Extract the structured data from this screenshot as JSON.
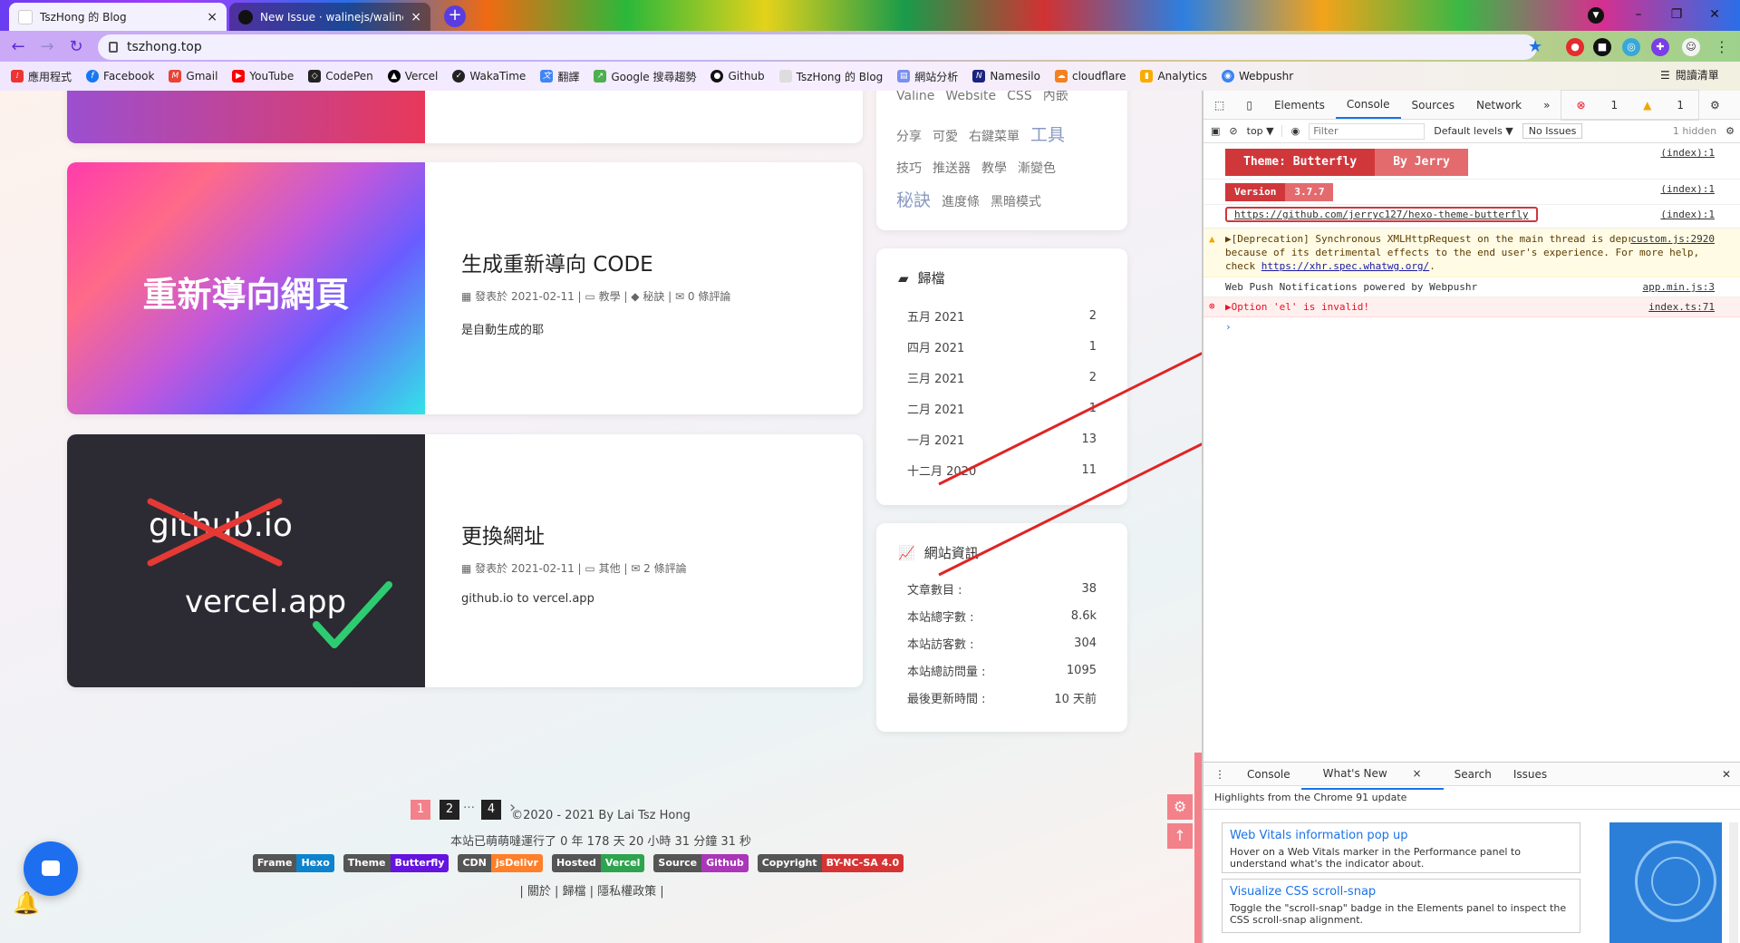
{
  "browser": {
    "tabs": [
      {
        "title": "TszHong 的 Blog",
        "close": "×"
      },
      {
        "title": "New Issue · walinejs/waline",
        "close": "×"
      }
    ],
    "new_tab": "+",
    "url": "tszhong.top",
    "window_controls": [
      "–",
      "❐",
      "✕"
    ],
    "bookmarks": [
      "應用程式",
      "Facebook",
      "Gmail",
      "YouTube",
      "CodePen",
      "Vercel",
      "WakaTime",
      "翻譯",
      "Google 搜尋趨勢",
      "Github",
      "TszHong 的 Blog",
      "網站分析",
      "Namesilo",
      "cloudflare",
      "Analytics",
      "Webpushr"
    ],
    "reading_list": "閱讀清單"
  },
  "blog": {
    "posts": [
      {
        "title": "生成重新導向 CODE",
        "cover_text": "重新導向網頁",
        "date": "發表於 2021-02-11",
        "category": "教學",
        "tag": "秘訣",
        "comments": "0 條評論",
        "excerpt": "是自動生成的耶"
      },
      {
        "title": "更換網址",
        "cover_text1": "github.io",
        "cover_text2": "vercel.app",
        "date": "發表於 2021-02-11",
        "category": "其他",
        "comments": "2 條評論",
        "excerpt": "github.io to vercel.app"
      }
    ],
    "tags_row0": [
      "Valine",
      "Website",
      "CSS",
      "內嵌"
    ],
    "tags": [
      "分享",
      "可愛",
      "右鍵菜單",
      "工具",
      "技巧",
      "推送器",
      "教學",
      "漸變色",
      "秘訣",
      "進度條",
      "黑暗模式"
    ],
    "archive": {
      "title": "歸檔",
      "items": [
        {
          "label": "五月 2021",
          "count": "2"
        },
        {
          "label": "四月 2021",
          "count": "1"
        },
        {
          "label": "三月 2021",
          "count": "2"
        },
        {
          "label": "二月 2021",
          "count": "1"
        },
        {
          "label": "一月 2021",
          "count": "13"
        },
        {
          "label": "十二月 2020",
          "count": "11"
        }
      ]
    },
    "siteinfo": {
      "title": "網站資訊",
      "items": [
        {
          "label": "文章數目 :",
          "value": "38"
        },
        {
          "label": "本站總字數 :",
          "value": "8.6k"
        },
        {
          "label": "本站訪客數 :",
          "value": "304"
        },
        {
          "label": "本站總訪問量 :",
          "value": "1095"
        },
        {
          "label": "最後更新時間 :",
          "value": "10 天前"
        }
      ]
    },
    "pagination": [
      "1",
      "2",
      "…",
      "4",
      "›"
    ],
    "footer": {
      "copyright": "©2020 - 2021 By Lai Tsz Hong",
      "runtime": "本站已萌萌噠運行了 0 年 178 天 20 小時 31 分鐘 31 秒",
      "badges": [
        {
          "l": "Frame",
          "r": "Hexo",
          "color": "#0e83cd"
        },
        {
          "l": "Theme",
          "r": "Butterfly",
          "color": "#6513df"
        },
        {
          "l": "CDN",
          "r": "jsDelivr",
          "color": "#ff7f2a"
        },
        {
          "l": "Hosted",
          "r": "Vercel",
          "color": "#2ea44f"
        },
        {
          "l": "Source",
          "r": "Github",
          "color": "#a937b8"
        },
        {
          "l": "Copyright",
          "r": "BY-NC-SA 4.0",
          "color": "#d63333"
        }
      ],
      "links": "| 關於 | 歸檔 | 隱私權政策 |"
    }
  },
  "devtools": {
    "tabs": [
      "Elements",
      "Console",
      "Sources",
      "Network",
      "»"
    ],
    "counts": {
      "errors": "1",
      "warnings": "1"
    },
    "toolbar": {
      "context": "top ▼",
      "filter_placeholder": "Filter",
      "levels": "Default levels ▼",
      "issues": "No Issues",
      "hidden": "1 hidden"
    },
    "console": [
      {
        "type": "banner",
        "l": "Theme: Butterfly",
        "r": "By Jerry",
        "src": "(index):1"
      },
      {
        "type": "version",
        "l": "Version",
        "r": "3.7.7",
        "src": "(index):1"
      },
      {
        "type": "link",
        "text": "https://github.com/jerryc127/hexo-theme-butterfly",
        "src": "(index):1"
      },
      {
        "type": "warn",
        "text": "▶[Deprecation] Synchronous XMLHttpRequest on the main thread is deprecated because of its detrimental effects to the end user's experience. For more help, check",
        "link": "https://xhr.spec.whatwg.org/",
        "src": "custom.js:2920"
      },
      {
        "type": "log",
        "text": "Web Push Notifications powered by Webpushr",
        "src": "app.min.js:3"
      },
      {
        "type": "error",
        "text": "▶Option 'el' is invalid!",
        "src": "index.ts:71"
      }
    ],
    "prompt": "›",
    "drawer": {
      "tabs": [
        "Console",
        "What's New",
        "Search",
        "Issues"
      ],
      "heading": "Highlights from the Chrome 91 update",
      "cards": [
        {
          "title": "Web Vitals information pop up",
          "text": "Hover on a Web Vitals marker in the Performance panel to understand what's the indicator about."
        },
        {
          "title": "Visualize CSS scroll-snap",
          "text": "Toggle the \"scroll-snap\" badge in the Elements panel to inspect the CSS scroll-snap alignment."
        }
      ]
    }
  }
}
